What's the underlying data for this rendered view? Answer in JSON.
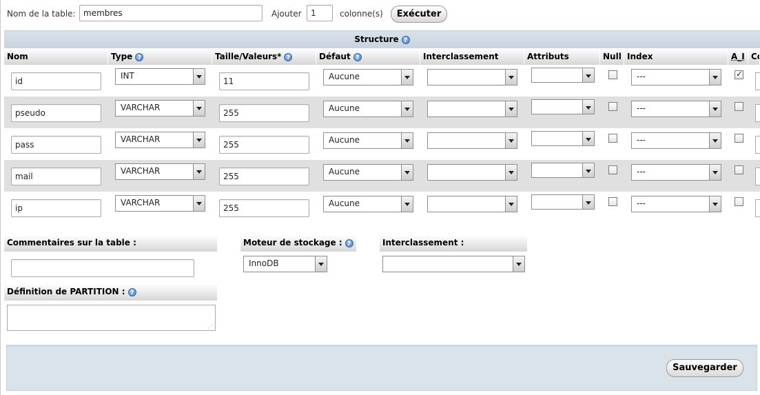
{
  "top": {
    "table_name_label": "Nom de la table:",
    "table_name_value": "membres",
    "add_label": "Ajouter",
    "add_count": "1",
    "columns_label": "colonne(s)",
    "execute_label": "Exécuter"
  },
  "structure": {
    "title": "Structure",
    "headers": {
      "nom": "Nom",
      "type": "Type",
      "taille": "Taille/Valeurs*",
      "defaut": "Défaut",
      "interclassement": "Interclassement",
      "attributs": "Attributs",
      "null": "Null",
      "index": "Index",
      "ai": "A_I",
      "co": "Co"
    },
    "rows": [
      {
        "nom": "id",
        "type": "INT",
        "taille": "11",
        "defaut": "Aucune",
        "interclassement": "",
        "attributs": "",
        "null": false,
        "index": "---",
        "ai": true
      },
      {
        "nom": "pseudo",
        "type": "VARCHAR",
        "taille": "255",
        "defaut": "Aucune",
        "interclassement": "",
        "attributs": "",
        "null": false,
        "index": "---",
        "ai": false
      },
      {
        "nom": "pass",
        "type": "VARCHAR",
        "taille": "255",
        "defaut": "Aucune",
        "interclassement": "",
        "attributs": "",
        "null": false,
        "index": "---",
        "ai": false
      },
      {
        "nom": "mail",
        "type": "VARCHAR",
        "taille": "255",
        "defaut": "Aucune",
        "interclassement": "",
        "attributs": "",
        "null": false,
        "index": "---",
        "ai": false
      },
      {
        "nom": "ip",
        "type": "VARCHAR",
        "taille": "255",
        "defaut": "Aucune",
        "interclassement": "",
        "attributs": "",
        "null": false,
        "index": "---",
        "ai": false
      }
    ]
  },
  "options": {
    "comments_label": "Commentaires sur la table :",
    "comments_value": "",
    "engine_label": "Moteur de stockage :",
    "engine_value": "InnoDB",
    "collation_label": "Interclassement :",
    "collation_value": "",
    "partition_label": "Définition de PARTITION :",
    "partition_value": ""
  },
  "footer": {
    "save_label": "Sauvegarder"
  },
  "icons": {
    "help": "help-icon"
  }
}
